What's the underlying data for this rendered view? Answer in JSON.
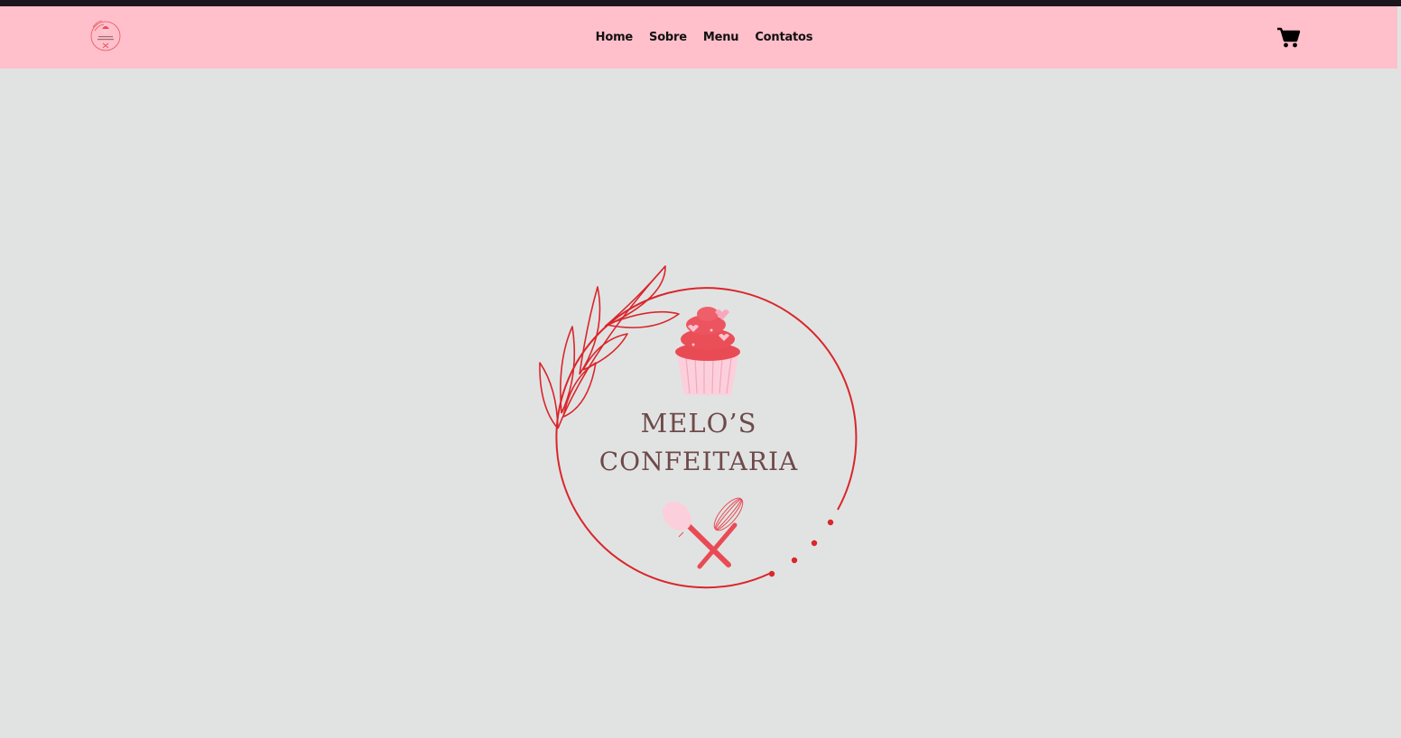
{
  "nav": {
    "links": [
      "Home",
      "Sobre",
      "Menu",
      "Contatos"
    ],
    "logo_icon": "brand-logo-icon",
    "cart_icon": "shopping-cart-icon"
  },
  "hero": {
    "brand_line_1": "MELO’S",
    "brand_line_2": "CONFEITARIA",
    "icons": [
      "leaf-branch-icon",
      "cupcake-icon",
      "spatula-whisk-icon"
    ]
  },
  "colors": {
    "navbar": "#ffbfcb",
    "background": "#e1e3e2",
    "topbar": "#1c1520",
    "accent_red": "#d9262c",
    "brand_text": "#6e4a4a"
  }
}
